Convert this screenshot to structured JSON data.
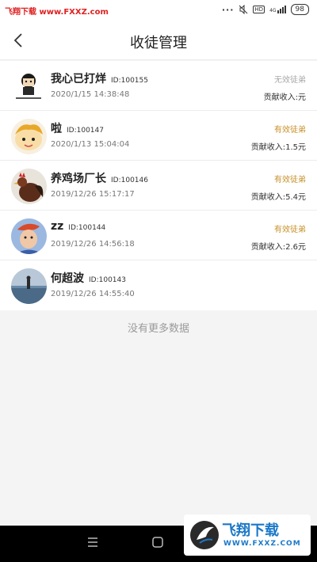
{
  "status_bar": {
    "watermark_text": "飞翔下载 www.FXXZ.com",
    "network_label": "4G",
    "battery": "98"
  },
  "header": {
    "title": "收徒管理"
  },
  "apprentices": [
    {
      "name": "我心已打烊",
      "id_label": "ID:100155",
      "time": "2020/1/15 14:38:48",
      "status": "无效徒弟",
      "income": "贡献收入:元"
    },
    {
      "name": "啦",
      "id_label": "ID:100147",
      "time": "2020/1/13 15:04:04",
      "status": "有效徒弟",
      "income": "贡献收入:1.5元"
    },
    {
      "name": "养鸡场厂长",
      "id_label": "ID:100146",
      "time": "2019/12/26 15:17:17",
      "status": "有效徒弟",
      "income": "贡献收入:5.4元"
    },
    {
      "name": "zz",
      "id_label": "ID:100144",
      "time": "2019/12/26 14:56:18",
      "status": "有效徒弟",
      "income": "贡献收入:2.6元"
    },
    {
      "name": "何超波",
      "id_label": "ID:100143",
      "time": "2019/12/26 14:55:40"
    }
  ],
  "footer": {
    "no_more": "没有更多数据"
  },
  "watermark": {
    "brand": "飞翔下载",
    "url": "WWW.FXXZ.COM"
  },
  "colors": {
    "valid_status": "#c8902a",
    "invalid_status": "#a8a8a8"
  },
  "icons": {
    "back": "back-arrow-icon",
    "menu": "menu-icon",
    "home": "home-icon"
  }
}
